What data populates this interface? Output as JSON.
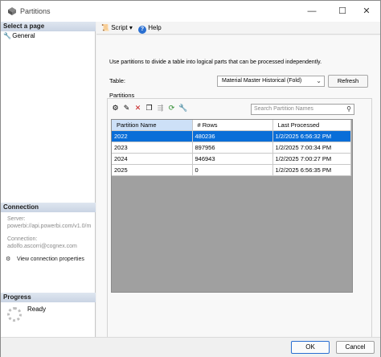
{
  "window": {
    "title": "Partitions",
    "minimize": "—",
    "maximize": "☐",
    "close": "✕"
  },
  "sidebar": {
    "select_page_header": "Select a page",
    "pages": [
      {
        "label": "General",
        "icon": "wrench-icon"
      }
    ],
    "connection_header": "Connection",
    "server_label": "Server:",
    "server_value": "powerbi://api.powerbi.com/v1.0/m",
    "connection_label": "Connection:",
    "connection_value": "adolfo.ascorri@cognex.com",
    "view_connection": "View connection properties",
    "progress_header": "Progress",
    "progress_status": "Ready"
  },
  "toolbar": {
    "script_label": "Script",
    "help_label": "Help"
  },
  "main": {
    "description": "Use partitions to divide a table into logical parts that can be processed independently.",
    "table_label": "Table:",
    "table_selected": "Material Master Historical (Fold)",
    "refresh_label": "Refresh",
    "partitions_label": "Partitions",
    "search_placeholder": "Search Partition Names",
    "columns": [
      "Partition Name",
      "# Rows",
      "Last Processed"
    ],
    "rows": [
      [
        "2022",
        "480236",
        "1/2/2025 6:56:32 PM"
      ],
      [
        "2023",
        "897956",
        "1/2/2025 7:00:34 PM"
      ],
      [
        "2024",
        "946943",
        "1/2/2025 7:00:27 PM"
      ],
      [
        "2025",
        "0",
        "1/2/2025 6:56:35 PM"
      ]
    ],
    "selected_row": 0
  },
  "footer": {
    "ok_label": "OK",
    "cancel_label": "Cancel"
  },
  "colors": {
    "selection": "#0a6ed8",
    "header_highlight": "#cde0f7"
  }
}
